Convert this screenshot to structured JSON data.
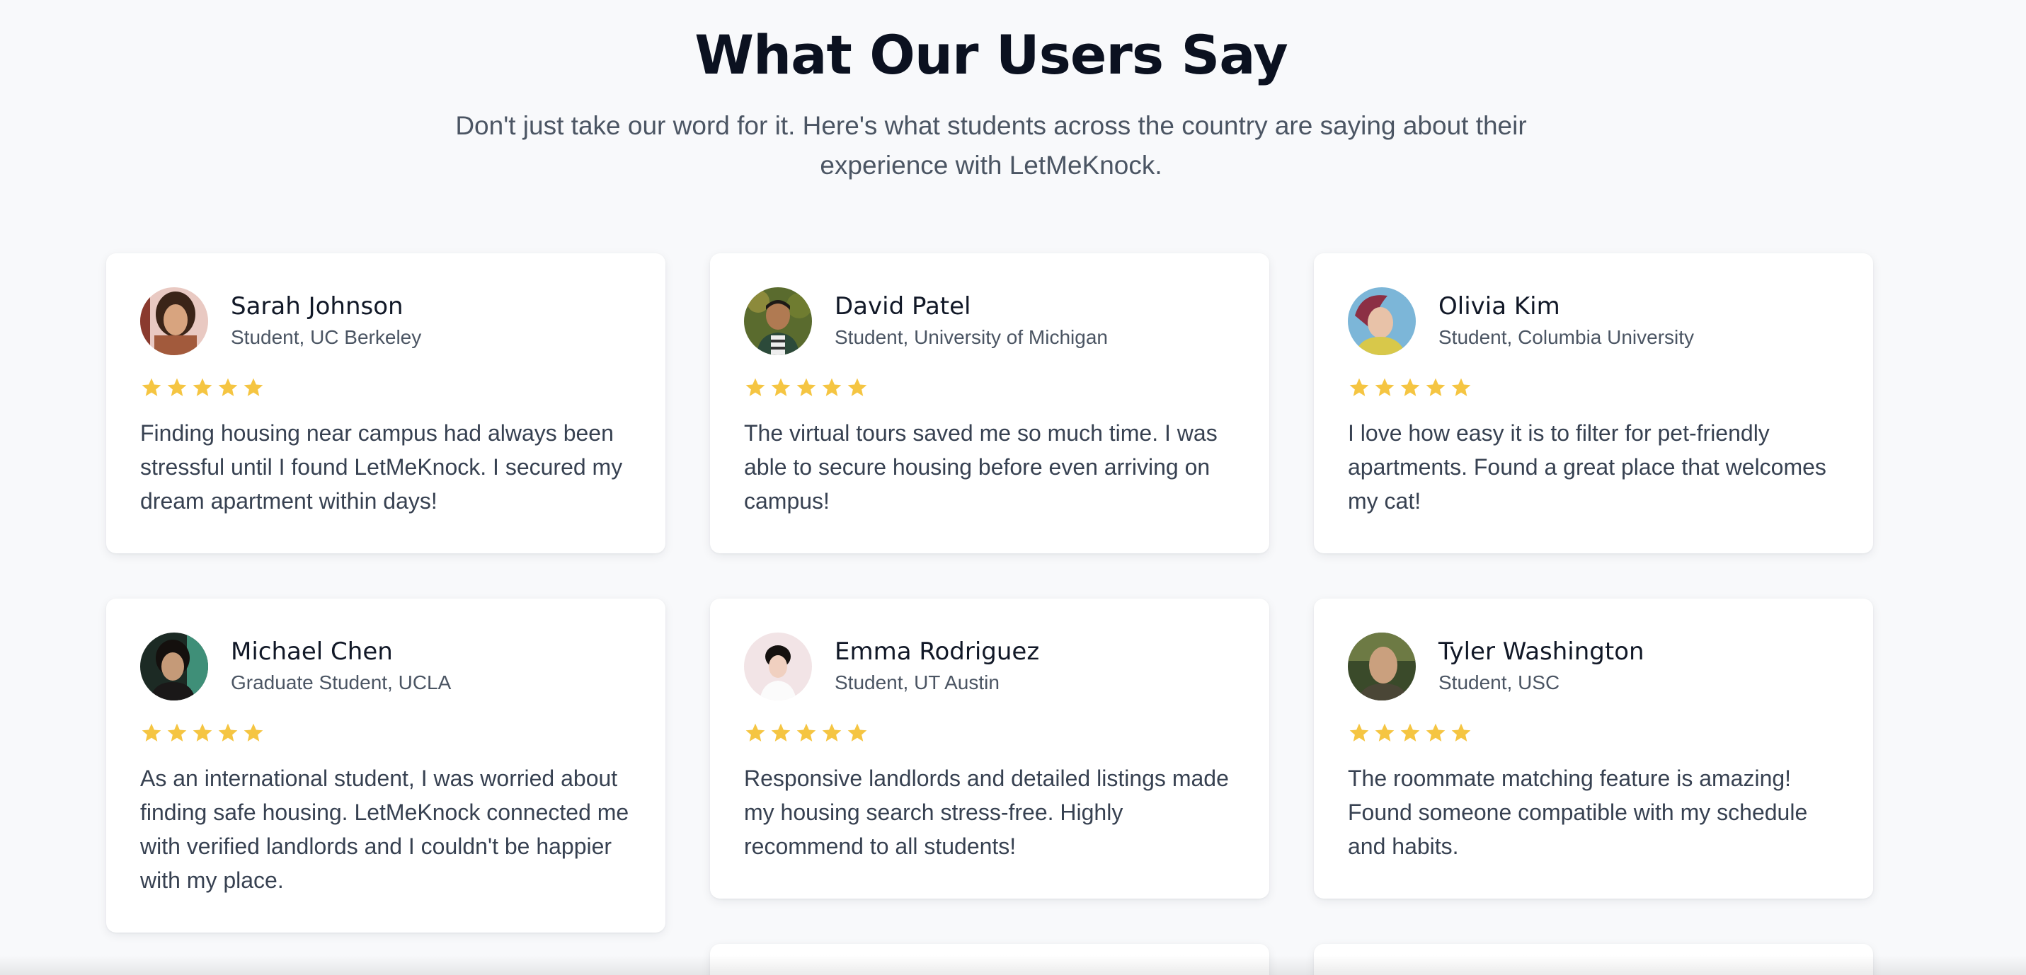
{
  "section": {
    "title": "What Our Users Say",
    "subtitle": "Don't just take our word for it. Here's what students across the country are saying about their experience with LetMeKnock."
  },
  "colors": {
    "star": "#f5c542",
    "background": "#f8f9fb",
    "card": "#ffffff"
  },
  "testimonials": [
    {
      "name": "Sarah Johnson",
      "role": "Student, UC Berkeley",
      "rating": 5,
      "quote": "Finding housing near campus had always been stressful until I found LetMeKnock. I secured my dream apartment within days!",
      "avatar_icon": "avatar-photo-icon"
    },
    {
      "name": "David Patel",
      "role": "Student, University of Michigan",
      "rating": 5,
      "quote": "The virtual tours saved me so much time. I was able to secure housing before even arriving on campus!",
      "avatar_icon": "avatar-photo-icon"
    },
    {
      "name": "Olivia Kim",
      "role": "Student, Columbia University",
      "rating": 5,
      "quote": "I love how easy it is to filter for pet-friendly apartments. Found a great place that welcomes my cat!",
      "avatar_icon": "avatar-photo-icon"
    },
    {
      "name": "Michael Chen",
      "role": "Graduate Student, UCLA",
      "rating": 5,
      "quote": "As an international student, I was worried about finding safe housing. LetMeKnock connected me with verified landlords and I couldn't be happier with my place.",
      "avatar_icon": "avatar-photo-icon"
    },
    {
      "name": "Emma Rodriguez",
      "role": "Student, UT Austin",
      "rating": 5,
      "quote": "Responsive landlords and detailed listings made my housing search stress-free. Highly recommend to all students!",
      "avatar_icon": "avatar-photo-icon"
    },
    {
      "name": "Tyler Washington",
      "role": "Student, USC",
      "rating": 5,
      "quote": "The roommate matching feature is amazing! Found someone compatible with my schedule and habits.",
      "avatar_icon": "avatar-photo-icon"
    }
  ]
}
